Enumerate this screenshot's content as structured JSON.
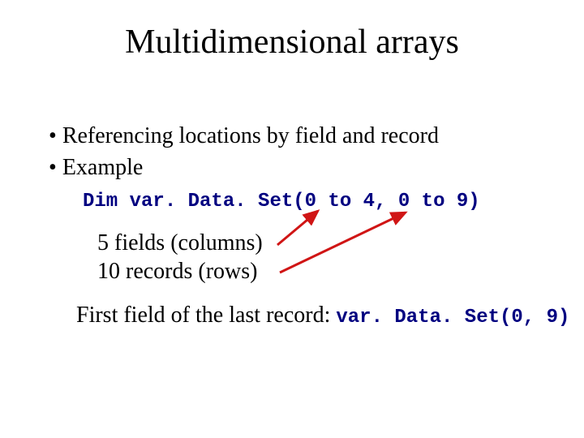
{
  "title": "Multidimensional arrays",
  "bullets": {
    "b1": "Referencing locations by field and record",
    "b2": "Example"
  },
  "code_line": "Dim var. Data. Set(0 to 4, 0 to 9)",
  "annotations": {
    "fields": "5 fields (columns)",
    "records": "10 records (rows)"
  },
  "last": {
    "prefix": "First field of the last record: ",
    "code": "var. Data. Set(0, 9)"
  },
  "colors": {
    "code": "#000080",
    "arrow": "#d01515"
  }
}
